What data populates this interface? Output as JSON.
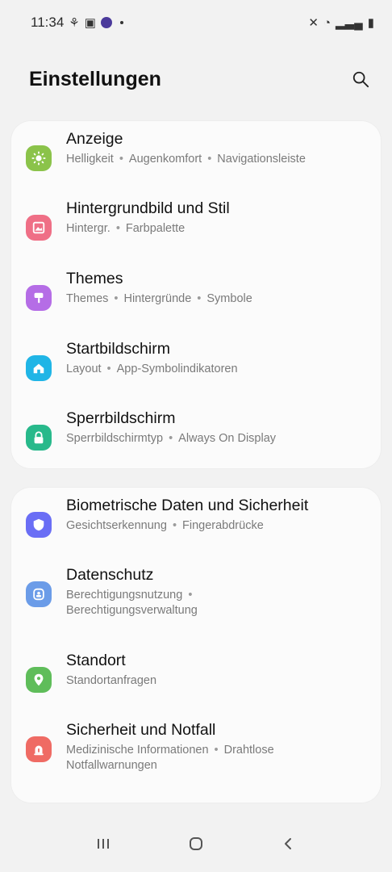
{
  "status_bar": {
    "time": "11:34",
    "left_icons": [
      "network-icon",
      "gallery-icon",
      "app-icon"
    ],
    "right_icons": [
      "mute-icon",
      "wifi-icon",
      "signal-icon",
      "battery-icon"
    ]
  },
  "header": {
    "title": "Einstellungen",
    "search_icon": "search-icon"
  },
  "groups": [
    {
      "items": [
        {
          "title": "Anzeige",
          "subtitle": [
            "Helligkeit",
            "Augenkomfort",
            "Navigationsleiste"
          ],
          "icon": "display-icon",
          "color": "#8bc34a"
        },
        {
          "title": "Hintergrundbild und Stil",
          "subtitle": [
            "Hintergr.",
            "Farbpalette"
          ],
          "icon": "wallpaper-icon",
          "color": "#ef6f86"
        },
        {
          "title": "Themes",
          "subtitle": [
            "Themes",
            "Hintergründe",
            "Symbole"
          ],
          "icon": "themes-icon",
          "color": "#b56de6"
        },
        {
          "title": "Startbildschirm",
          "subtitle": [
            "Layout",
            "App-Symbolindikatoren"
          ],
          "icon": "home-icon",
          "color": "#20b5e6"
        },
        {
          "title": "Sperrbildschirm",
          "subtitle": [
            "Sperrbildschirmtyp",
            "Always On Display"
          ],
          "icon": "lock-icon",
          "color": "#28b98b"
        }
      ]
    },
    {
      "items": [
        {
          "title": "Biometrische Daten und Sicherheit",
          "subtitle": [
            "Gesichtserkennung",
            "Fingerabdrücke"
          ],
          "icon": "shield-icon",
          "color": "#6a6ef5"
        },
        {
          "title": "Datenschutz",
          "subtitle": [
            "Berechtigungsnutzung",
            "Berechtigungsverwaltung"
          ],
          "icon": "privacy-icon",
          "color": "#6b9ce8"
        },
        {
          "title": "Standort",
          "subtitle": [
            "Standortanfragen"
          ],
          "icon": "location-icon",
          "color": "#5fbd5a"
        },
        {
          "title": "Sicherheit und Notfall",
          "subtitle": [
            "Medizinische Informationen",
            "Drahtlose Notfallwarnungen"
          ],
          "icon": "emergency-icon",
          "color": "#ef6b64"
        }
      ]
    }
  ],
  "nav_bar": {
    "icons": [
      "recents-icon",
      "home-button-icon",
      "back-icon"
    ]
  }
}
